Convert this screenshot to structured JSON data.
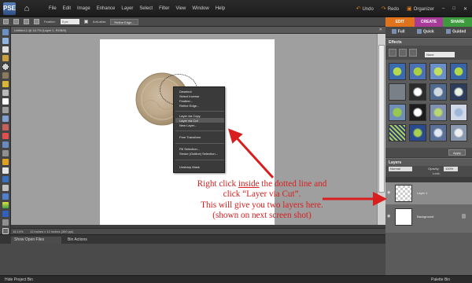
{
  "app": {
    "logo_text": "PSE",
    "menu": [
      "File",
      "Edit",
      "Image",
      "Enhance",
      "Layer",
      "Select",
      "Filter",
      "View",
      "Window",
      "Help"
    ],
    "undo_label": "Undo",
    "redo_label": "Redo",
    "organizer_label": "Organizer"
  },
  "options_bar": {
    "feather_label": "Feather:",
    "feather_value": "0 px",
    "antialias_label": "Anti-alias",
    "refine_edge_label": "Refine Edge..."
  },
  "mode_tabs": [
    "EDIT",
    "CREATE",
    "SHARE"
  ],
  "sub_tabs": [
    "Full",
    "Quick",
    "Guided"
  ],
  "document": {
    "tab_title": "Untitled-1 @ 16.7% (Layer 1, RGB/8)",
    "zoom": "16.14%",
    "doc_size": "12 inches x 12 inches (300 ppi)"
  },
  "context_menu": {
    "group1": [
      "Deselect",
      "Select Inverse",
      "Feather...",
      "Refine Edge..."
    ],
    "group2": [
      "Layer via Copy",
      "Layer via Cut",
      "New Layer..."
    ],
    "group3": [
      "Free Transform"
    ],
    "group4": [
      "Fill Selection...",
      "Stroke (Outline) Selection..."
    ],
    "group5": [
      "Unsharp Mask"
    ],
    "highlighted": "Layer via Cut"
  },
  "project_bin": {
    "show_open_files": "Show Open Files",
    "bin_actions": "Bin Actions"
  },
  "bottom_bar": {
    "hide_project_bin": "Hide Project Bin",
    "palette_bin": "Palette Bin"
  },
  "effects_panel": {
    "title": "Effects",
    "filter_dropdown": "None",
    "apply_label": "Apply"
  },
  "layers_panel": {
    "title": "Layers",
    "blend_mode": "Normal",
    "opacity_label": "Opacity:",
    "opacity_value": "100%",
    "lock_label": "Lock:",
    "layers": [
      "Layer 1",
      "Background"
    ]
  },
  "annotation": {
    "line1_before": "Right click ",
    "line1_underlined": "inside",
    "line1_after": " the dotted line and",
    "line2": "click “Layer via Cut”.",
    "line3": "This will give you two layers here.",
    "line4": "(shown on next screen shot)"
  },
  "colors": {
    "accent_red": "#d81e1e",
    "edit_tab": "#e0731c",
    "create_tab": "#a83a9a",
    "share_tab": "#3e9a3e"
  }
}
